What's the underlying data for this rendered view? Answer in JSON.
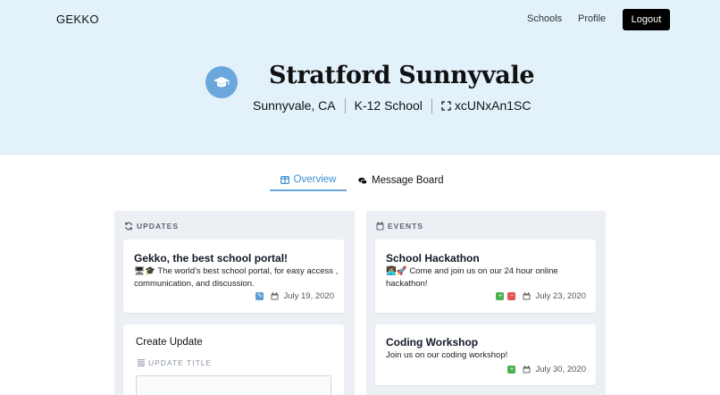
{
  "nav": {
    "brand": "GEKKO",
    "links": [
      "Schools",
      "Profile"
    ],
    "logout_label": "Logout"
  },
  "school": {
    "name": "Stratford Sunnyvale",
    "location": "Sunnyvale, CA",
    "type": "K-12 School",
    "code": "xcUNxAn1SC",
    "avatar_icon": "graduation-cap-icon"
  },
  "tabs": [
    {
      "label": "Overview",
      "icon": "columns-icon",
      "active": true
    },
    {
      "label": "Message Board",
      "icon": "comments-icon",
      "active": false
    }
  ],
  "updates": {
    "heading": "UPDATES",
    "items": [
      {
        "title": "Gekko, the best school portal!",
        "body_emoji": "🖥🎓",
        "body": "The world's best school portal, for easy access , communication, and discussion.",
        "date": "July 19, 2020"
      }
    ],
    "create": {
      "title": "Create Update",
      "field_label": "UPDATE TITLE"
    }
  },
  "events": {
    "heading": "EVENTS",
    "items": [
      {
        "title": "School Hackathon",
        "body_emoji": "👩🏽‍💻🚀",
        "body": "Come and join us on our 24 hour online hackathon!",
        "date": "July 23, 2020"
      },
      {
        "title": "Coding Workshop",
        "body": "Join us on our coding workshop!",
        "date": "July 30, 2020"
      }
    ]
  },
  "colors": {
    "hero_bg": "#e3f1fb",
    "accent": "#3f8fd2",
    "avatar_bg": "#6aa7dc",
    "add_green": "#4caf50",
    "remove_red": "#e25555"
  }
}
